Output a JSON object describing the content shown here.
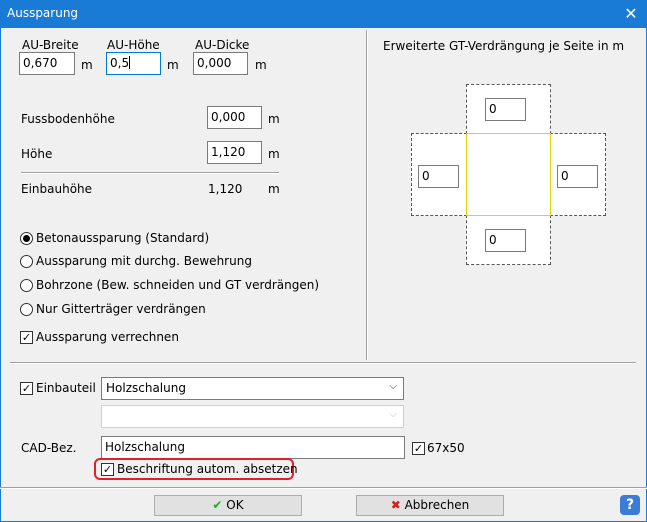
{
  "window": {
    "title": "Aussparung",
    "close_glyph": "✕"
  },
  "dims": {
    "breite_label": "AU-Breite",
    "breite_value": "0,670",
    "hoehe_label": "AU-Höhe",
    "hoehe_value": "0,5",
    "dicke_label": "AU-Dicke",
    "dicke_value": "0,000",
    "unit": "m"
  },
  "levels": {
    "fussboden_label": "Fussbodenhöhe",
    "fussboden_value": "0,000",
    "hoehe_label": "Höhe",
    "hoehe_value": "1,120",
    "einbau_label": "Einbauhöhe",
    "einbau_value": "1,120",
    "unit": "m"
  },
  "options": [
    {
      "label": "Betonaussparung (Standard)",
      "selected": true
    },
    {
      "label": "Aussparung mit durchg. Bewehrung",
      "selected": false
    },
    {
      "label": "Bohrzone (Bew. schneiden und GT verdrängen)",
      "selected": false
    },
    {
      "label": "Nur Gitterträger verdrängen",
      "selected": false
    }
  ],
  "verrechnen": {
    "label": "Aussparung verrechnen",
    "checked": true
  },
  "gt": {
    "title": "Erweiterte GT-Verdrängung je Seite in m",
    "top": "0",
    "left": "0",
    "right": "0",
    "bottom": "0"
  },
  "einbauteil": {
    "label": "Einbauteil",
    "checked": true,
    "value": "Holzschalung",
    "second_value": ""
  },
  "cad": {
    "label": "CAD-Bez.",
    "value": "Holzschalung",
    "size_label": "67x50",
    "size_checked": true
  },
  "beschriftung": {
    "label": "Beschriftung autom. absetzen",
    "checked": true
  },
  "buttons": {
    "ok": "OK",
    "cancel": "Abbrechen",
    "help": "?"
  },
  "colors": {
    "titlebar": "#1a7bd6",
    "ok_icon": "#2e9e2e",
    "cancel_icon": "#d42020",
    "highlight": "#e0202a"
  }
}
